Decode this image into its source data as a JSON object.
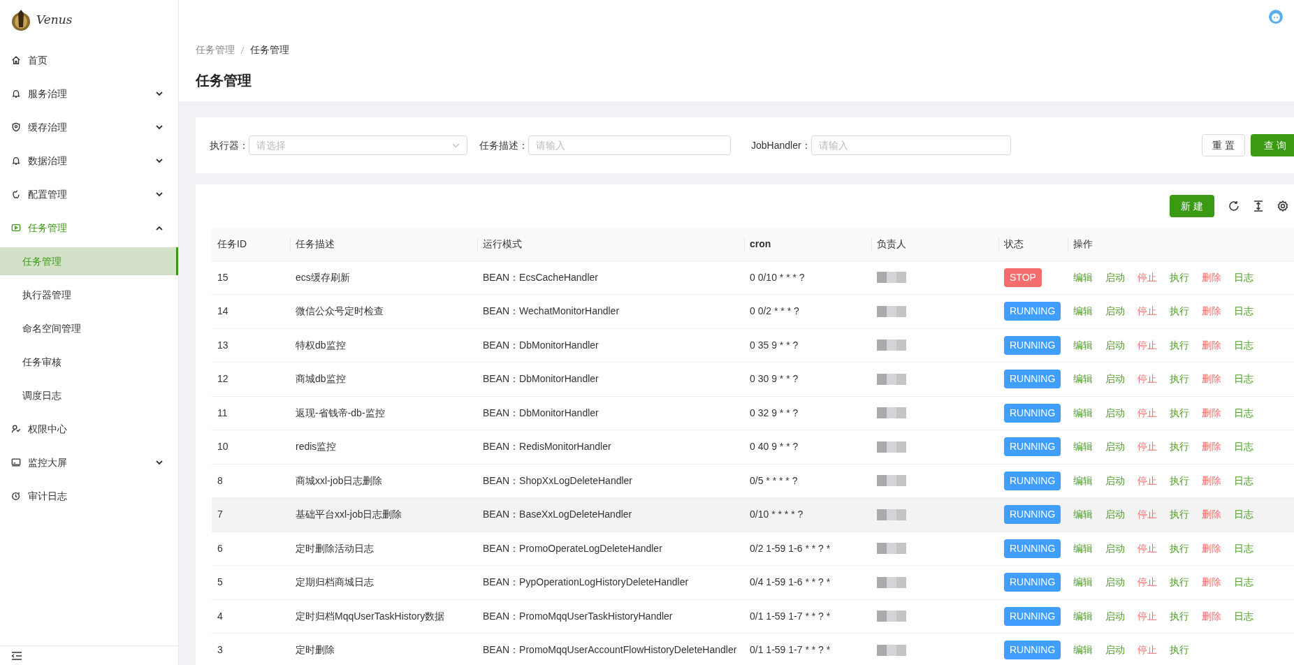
{
  "logo": {
    "text": "Venus"
  },
  "sidebar": {
    "items": [
      {
        "label": "首页",
        "selected": false
      },
      {
        "label": "服务治理",
        "selected": false,
        "expanded": false
      },
      {
        "label": "缓存治理",
        "selected": false,
        "expanded": false
      },
      {
        "label": "数据治理",
        "selected": false,
        "expanded": false
      },
      {
        "label": "配置管理",
        "selected": false,
        "expanded": false
      },
      {
        "label": "任务管理",
        "selected": true,
        "expanded": true,
        "children": [
          {
            "label": "任务管理",
            "selected": true
          },
          {
            "label": "执行器管理",
            "selected": false
          },
          {
            "label": "命名空间管理",
            "selected": false
          },
          {
            "label": "任务审核",
            "selected": false
          },
          {
            "label": "调度日志",
            "selected": false
          }
        ]
      },
      {
        "label": "权限中心",
        "selected": false
      },
      {
        "label": "监控大屏",
        "selected": false,
        "expanded": false
      },
      {
        "label": "审计日志",
        "selected": false
      }
    ]
  },
  "breadcrumb": [
    {
      "label": "任务管理"
    },
    {
      "label": "任务管理"
    }
  ],
  "page_title": "任务管理",
  "filters": [
    {
      "label": "执行器：",
      "placeholder": "请选择",
      "kind": "select"
    },
    {
      "label": "任务描述：",
      "placeholder": "请输入",
      "kind": "input"
    },
    {
      "label": "JobHandler：",
      "placeholder": "请输入",
      "kind": "input"
    }
  ],
  "filter_buttons": [
    {
      "label": "重 置",
      "kind": "default"
    },
    {
      "label": "查 询",
      "kind": "primary"
    }
  ],
  "new_button": "新 建",
  "table": {
    "columns": [
      "任务ID",
      "任务描述",
      "运行模式",
      "cron",
      "负责人",
      "状态",
      "操作"
    ],
    "rows": [
      {
        "id": "15",
        "desc": "ecs缓存刷新",
        "mode": "BEAN：EcsCacheHandler",
        "cron": "0 0/10 * * * ?",
        "highlighted": false,
        "status": {
          "text": "STOP",
          "kind": "stop"
        },
        "actions": [
          {
            "label": "编辑",
            "kind": "normal"
          },
          {
            "label": "启动",
            "kind": "normal"
          },
          {
            "label": "停止",
            "kind": "danger"
          },
          {
            "label": "执行",
            "kind": "normal"
          },
          {
            "label": "删除",
            "kind": "danger"
          },
          {
            "label": "日志",
            "kind": "normal"
          }
        ]
      },
      {
        "id": "14",
        "desc": "微信公众号定时检查",
        "mode": "BEAN：WechatMonitorHandler",
        "cron": "0 0/2 * * * ?",
        "highlighted": false,
        "status": {
          "text": "RUNNING",
          "kind": "running"
        },
        "actions": [
          {
            "label": "编辑",
            "kind": "normal"
          },
          {
            "label": "启动",
            "kind": "normal"
          },
          {
            "label": "停止",
            "kind": "danger"
          },
          {
            "label": "执行",
            "kind": "normal"
          },
          {
            "label": "删除",
            "kind": "danger"
          },
          {
            "label": "日志",
            "kind": "normal"
          }
        ]
      },
      {
        "id": "13",
        "desc": "特权db监控",
        "mode": "BEAN：DbMonitorHandler",
        "cron": "0 35 9 * * ?",
        "highlighted": false,
        "status": {
          "text": "RUNNING",
          "kind": "running"
        },
        "actions": [
          {
            "label": "编辑",
            "kind": "normal"
          },
          {
            "label": "启动",
            "kind": "normal"
          },
          {
            "label": "停止",
            "kind": "danger"
          },
          {
            "label": "执行",
            "kind": "normal"
          },
          {
            "label": "删除",
            "kind": "danger"
          },
          {
            "label": "日志",
            "kind": "normal"
          }
        ]
      },
      {
        "id": "12",
        "desc": "商城db监控",
        "mode": "BEAN：DbMonitorHandler",
        "cron": "0 30 9 * * ?",
        "highlighted": false,
        "status": {
          "text": "RUNNING",
          "kind": "running"
        },
        "actions": [
          {
            "label": "编辑",
            "kind": "normal"
          },
          {
            "label": "启动",
            "kind": "normal"
          },
          {
            "label": "停止",
            "kind": "danger"
          },
          {
            "label": "执行",
            "kind": "normal"
          },
          {
            "label": "删除",
            "kind": "danger"
          },
          {
            "label": "日志",
            "kind": "normal"
          }
        ]
      },
      {
        "id": "11",
        "desc": "返现-省钱帝-db-监控",
        "mode": "BEAN：DbMonitorHandler",
        "cron": "0 32 9 * * ?",
        "highlighted": false,
        "status": {
          "text": "RUNNING",
          "kind": "running"
        },
        "actions": [
          {
            "label": "编辑",
            "kind": "normal"
          },
          {
            "label": "启动",
            "kind": "normal"
          },
          {
            "label": "停止",
            "kind": "danger"
          },
          {
            "label": "执行",
            "kind": "normal"
          },
          {
            "label": "删除",
            "kind": "danger"
          },
          {
            "label": "日志",
            "kind": "normal"
          }
        ]
      },
      {
        "id": "10",
        "desc": "redis监控",
        "mode": "BEAN：RedisMonitorHandler",
        "cron": "0 40 9 * * ?",
        "highlighted": false,
        "status": {
          "text": "RUNNING",
          "kind": "running"
        },
        "actions": [
          {
            "label": "编辑",
            "kind": "normal"
          },
          {
            "label": "启动",
            "kind": "normal"
          },
          {
            "label": "停止",
            "kind": "danger"
          },
          {
            "label": "执行",
            "kind": "normal"
          },
          {
            "label": "删除",
            "kind": "danger"
          },
          {
            "label": "日志",
            "kind": "normal"
          }
        ]
      },
      {
        "id": "8",
        "desc": "商城xxl-job日志删除",
        "mode": "BEAN：ShopXxLogDeleteHandler",
        "cron": "0/5 * * * * ?",
        "highlighted": false,
        "status": {
          "text": "RUNNING",
          "kind": "running"
        },
        "actions": [
          {
            "label": "编辑",
            "kind": "normal"
          },
          {
            "label": "启动",
            "kind": "normal"
          },
          {
            "label": "停止",
            "kind": "danger"
          },
          {
            "label": "执行",
            "kind": "normal"
          },
          {
            "label": "删除",
            "kind": "danger"
          },
          {
            "label": "日志",
            "kind": "normal"
          }
        ]
      },
      {
        "id": "7",
        "desc": "基础平台xxl-job日志删除",
        "mode": "BEAN：BaseXxLogDeleteHandler",
        "cron": "0/10 * * * * ?",
        "highlighted": true,
        "status": {
          "text": "RUNNING",
          "kind": "running"
        },
        "actions": [
          {
            "label": "编辑",
            "kind": "normal"
          },
          {
            "label": "启动",
            "kind": "normal"
          },
          {
            "label": "停止",
            "kind": "danger"
          },
          {
            "label": "执行",
            "kind": "normal"
          },
          {
            "label": "删除",
            "kind": "danger"
          },
          {
            "label": "日志",
            "kind": "normal"
          }
        ]
      },
      {
        "id": "6",
        "desc": "定时删除活动日志",
        "mode": "BEAN：PromoOperateLogDeleteHandler",
        "cron": "0/2 1-59 1-6 * * ? *",
        "highlighted": false,
        "status": {
          "text": "RUNNING",
          "kind": "running"
        },
        "actions": [
          {
            "label": "编辑",
            "kind": "normal"
          },
          {
            "label": "启动",
            "kind": "normal"
          },
          {
            "label": "停止",
            "kind": "danger"
          },
          {
            "label": "执行",
            "kind": "normal"
          },
          {
            "label": "删除",
            "kind": "danger"
          },
          {
            "label": "日志",
            "kind": "normal"
          }
        ]
      },
      {
        "id": "5",
        "desc": "定期归档商城日志",
        "mode": "BEAN：PypOperationLogHistoryDeleteHandler",
        "cron": "0/4 1-59 1-6 * * ? *",
        "highlighted": false,
        "status": {
          "text": "RUNNING",
          "kind": "running"
        },
        "actions": [
          {
            "label": "编辑",
            "kind": "normal"
          },
          {
            "label": "启动",
            "kind": "normal"
          },
          {
            "label": "停止",
            "kind": "danger"
          },
          {
            "label": "执行",
            "kind": "normal"
          },
          {
            "label": "删除",
            "kind": "danger"
          },
          {
            "label": "日志",
            "kind": "normal"
          }
        ]
      },
      {
        "id": "4",
        "desc": "定时归档MqqUserTaskHistory数据",
        "mode": "BEAN：PromoMqqUserTaskHistoryHandler",
        "cron": "0/1 1-59 1-7 * * ? *",
        "highlighted": false,
        "status": {
          "text": "RUNNING",
          "kind": "running"
        },
        "actions": [
          {
            "label": "编辑",
            "kind": "normal"
          },
          {
            "label": "启动",
            "kind": "normal"
          },
          {
            "label": "停止",
            "kind": "danger"
          },
          {
            "label": "执行",
            "kind": "normal"
          },
          {
            "label": "删除",
            "kind": "danger"
          },
          {
            "label": "日志",
            "kind": "normal"
          }
        ]
      },
      {
        "id": "3",
        "desc": "定时删除",
        "mode": "BEAN：PromoMqqUserAccountFlowHistoryDeleteHandler",
        "cron": "0/1 1-59 1-7 * * ? *",
        "highlighted": false,
        "status": {
          "text": "RUNNING",
          "kind": "running"
        },
        "actions": [
          {
            "label": "编辑",
            "kind": "normal"
          },
          {
            "label": "启动",
            "kind": "normal"
          },
          {
            "label": "停止",
            "kind": "danger"
          },
          {
            "label": "执行",
            "kind": "normal"
          }
        ]
      }
    ]
  }
}
